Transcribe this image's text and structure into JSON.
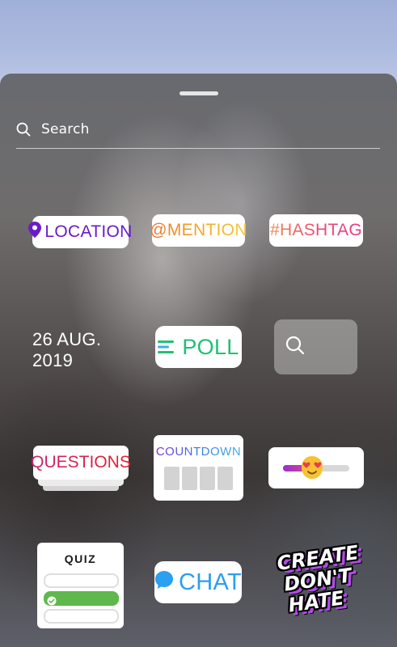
{
  "search": {
    "placeholder": "Search",
    "icon": "search-icon"
  },
  "stickers": {
    "location": {
      "label": "LOCATION",
      "icon": "location-pin-icon",
      "color": "#6a1bc9"
    },
    "mention": {
      "label": "@MENTION"
    },
    "hashtag": {
      "label": "#HASHTAG"
    },
    "date": {
      "label": "26 AUG. 2019"
    },
    "poll": {
      "label": "POLL",
      "icon": "poll-lines-icon",
      "color": "#1fc173"
    },
    "gif_search": {
      "icon": "search-icon"
    },
    "questions": {
      "label": "QUESTIONS"
    },
    "countdown": {
      "label": "COUNTDOWN"
    },
    "emoji_slider": {
      "icon": "heart-eyes-emoji-icon",
      "value": 0.35
    },
    "quiz": {
      "label": "QUIZ",
      "icon": "check-icon"
    },
    "chat": {
      "label": "CHAT",
      "icon": "chat-bubble-icon",
      "color": "#2b9ff0"
    },
    "create_dont_hate": {
      "lines": [
        "CREATE",
        "DON'T",
        "HATE"
      ]
    }
  }
}
